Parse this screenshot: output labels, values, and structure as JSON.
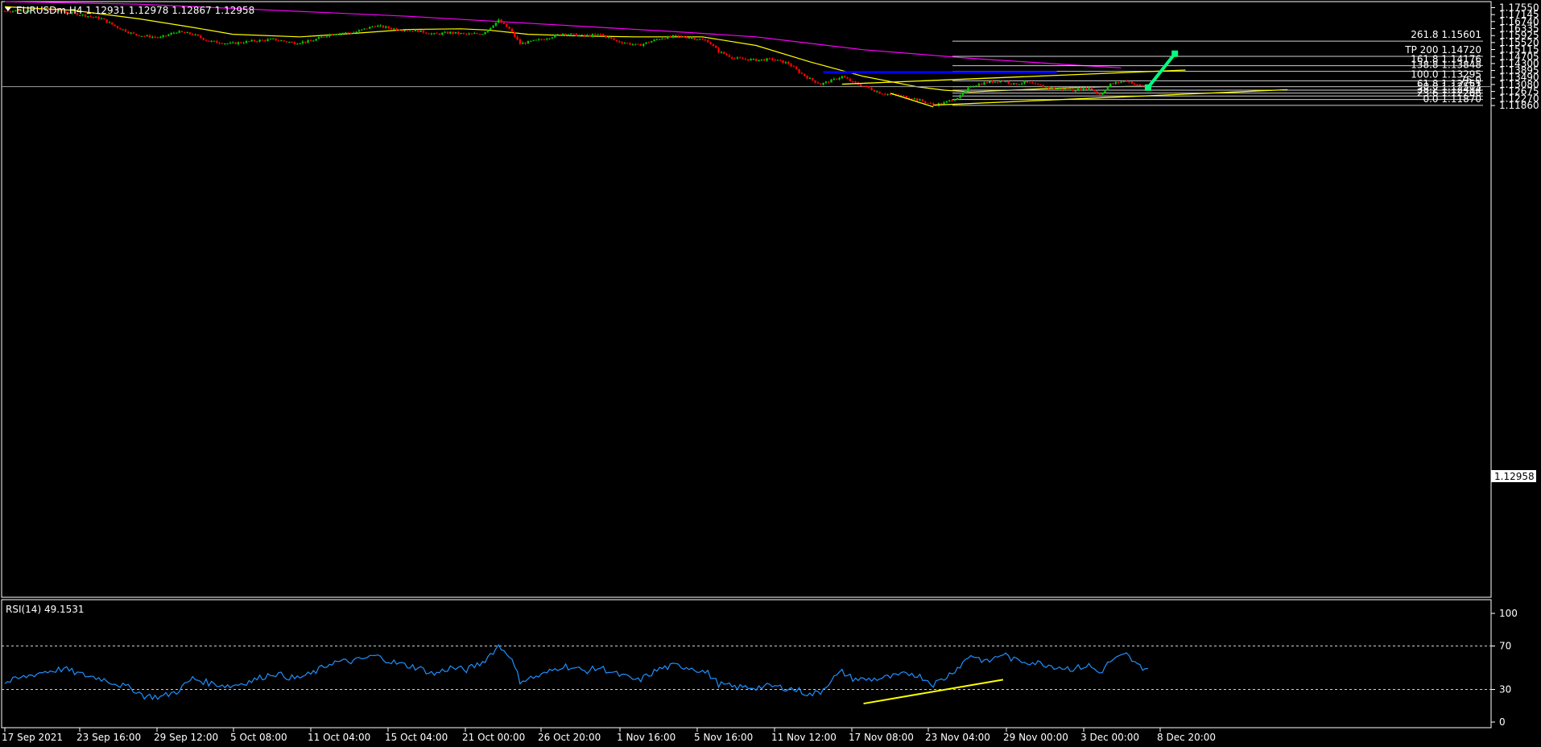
{
  "header": {
    "title": "EURUSDm,H4  1.12931 1.12978 1.12867 1.12958"
  },
  "price_tag": "1.12958",
  "rsi_header": "RSI(14) 49.1531",
  "colors": {
    "background": "#000000",
    "bull": "#00c800",
    "bear": "#ff0000",
    "ma_fast": "#ffff00",
    "ma_slow": "#ff00ff",
    "rsi": "#1e90ff",
    "zone": "#0000ff",
    "projection": "#00ff80",
    "grid": "#ffffff"
  },
  "chart_data": [
    {
      "type": "candlestick",
      "symbol": "EURUSDm",
      "timeframe": "H4",
      "ohlc_header": {
        "open": 1.12931,
        "high": 1.12978,
        "low": 1.12867,
        "close": 1.12958
      },
      "y_ticks": [
        "1.17550",
        "1.17145",
        "1.16740",
        "1.16335",
        "1.15925",
        "1.15520",
        "1.15115",
        "1.14705",
        "1.14300",
        "1.13895",
        "1.13490",
        "1.13080",
        "1.12675",
        "1.12270",
        "1.11860"
      ],
      "ylim": [
        1.116,
        1.179
      ],
      "x_ticks": [
        "17 Sep 2021",
        "23 Sep 16:00",
        "29 Sep 12:00",
        "5 Oct 08:00",
        "11 Oct 04:00",
        "15 Oct 04:00",
        "21 Oct 00:00",
        "26 Oct 20:00",
        "1 Nov 16:00",
        "5 Nov 16:00",
        "11 Nov 12:00",
        "17 Nov 08:00",
        "23 Nov 04:00",
        "29 Nov 00:00",
        "3 Dec 00:00",
        "8 Dec 20:00"
      ],
      "close_path": [
        [
          0,
          1.1735
        ],
        [
          8,
          1.174
        ],
        [
          14,
          1.1745
        ],
        [
          22,
          1.173
        ],
        [
          28,
          1.1715
        ],
        [
          36,
          1.169
        ],
        [
          42,
          1.164
        ],
        [
          48,
          1.16
        ],
        [
          52,
          1.159
        ],
        [
          58,
          1.158
        ],
        [
          64,
          1.1615
        ],
        [
          70,
          1.16
        ],
        [
          76,
          1.156
        ],
        [
          84,
          1.1545
        ],
        [
          92,
          1.156
        ],
        [
          100,
          1.157
        ],
        [
          108,
          1.155
        ],
        [
          114,
          1.156
        ],
        [
          122,
          1.1605
        ],
        [
          130,
          1.161
        ],
        [
          138,
          1.165
        ],
        [
          146,
          1.163
        ],
        [
          154,
          1.162
        ],
        [
          160,
          1.16
        ],
        [
          166,
          1.161
        ],
        [
          172,
          1.16
        ],
        [
          178,
          1.1605
        ],
        [
          184,
          1.168
        ],
        [
          188,
          1.163
        ],
        [
          192,
          1.1545
        ],
        [
          200,
          1.157
        ],
        [
          208,
          1.1605
        ],
        [
          216,
          1.159
        ],
        [
          222,
          1.16
        ],
        [
          228,
          1.156
        ],
        [
          236,
          1.1535
        ],
        [
          244,
          1.1575
        ],
        [
          250,
          1.159
        ],
        [
          256,
          1.158
        ],
        [
          262,
          1.156
        ],
        [
          266,
          1.15
        ],
        [
          272,
          1.146
        ],
        [
          280,
          1.145
        ],
        [
          286,
          1.1455
        ],
        [
          292,
          1.143
        ],
        [
          296,
          1.138
        ],
        [
          300,
          1.134
        ],
        [
          304,
          1.131
        ],
        [
          308,
          1.133
        ],
        [
          312,
          1.1355
        ],
        [
          316,
          1.132
        ],
        [
          320,
          1.13
        ],
        [
          326,
          1.126
        ],
        [
          332,
          1.1245
        ],
        [
          338,
          1.123
        ],
        [
          342,
          1.121
        ],
        [
          346,
          1.119
        ],
        [
          350,
          1.12
        ],
        [
          356,
          1.124
        ],
        [
          360,
          1.13
        ],
        [
          366,
          1.132
        ],
        [
          372,
          1.133
        ],
        [
          376,
          1.131
        ],
        [
          380,
          1.132
        ],
        [
          386,
          1.13
        ],
        [
          392,
          1.1285
        ],
        [
          398,
          1.1275
        ],
        [
          404,
          1.129
        ],
        [
          408,
          1.125
        ],
        [
          412,
          1.131
        ],
        [
          418,
          1.133
        ],
        [
          422,
          1.1305
        ],
        [
          426,
          1.1294
        ]
      ],
      "series": [
        {
          "name": "MA fast (yellow)",
          "points": [
            [
              0,
              1.176
            ],
            [
              25,
              1.174
            ],
            [
              50,
              1.169
            ],
            [
              70,
              1.164
            ],
            [
              85,
              1.16
            ],
            [
              110,
              1.1585
            ],
            [
              130,
              1.1605
            ],
            [
              150,
              1.1628
            ],
            [
              170,
              1.1632
            ],
            [
              180,
              1.1625
            ],
            [
              195,
              1.16
            ],
            [
              215,
              1.159
            ],
            [
              235,
              1.1585
            ],
            [
              260,
              1.1585
            ],
            [
              280,
              1.1535
            ],
            [
              300,
              1.144
            ],
            [
              320,
              1.1355
            ],
            [
              340,
              1.1295
            ],
            [
              350,
              1.1275
            ],
            [
              360,
              1.1265
            ],
            [
              375,
              1.1275
            ],
            [
              390,
              1.1285
            ],
            [
              410,
              1.1295
            ],
            [
              425,
              1.1298
            ]
          ]
        },
        {
          "name": "MA slow (magenta)",
          "points": [
            [
              0,
              1.179
            ],
            [
              50,
              1.1775
            ],
            [
              100,
              1.174
            ],
            [
              150,
              1.1705
            ],
            [
              200,
              1.166
            ],
            [
              250,
              1.1615
            ],
            [
              280,
              1.1585
            ],
            [
              320,
              1.151
            ],
            [
              360,
              1.146
            ],
            [
              400,
              1.142
            ],
            [
              416,
              1.1405
            ]
          ]
        }
      ],
      "fibonacci": [
        {
          "label": "261.8 1.15601",
          "price": 1.15601
        },
        {
          "label": "TP 200 1.14720",
          "price": 1.1472
        },
        {
          "label": "161.8 1.14176",
          "price": 1.14176
        },
        {
          "label": "138.8 1.13848",
          "price": 1.13848
        },
        {
          "label": "100.0 1.13295",
          "price": 1.13295
        },
        {
          "label": "75.0",
          "price": 1.12958
        },
        {
          "label": "61.8 1.12751",
          "price": 1.12751
        },
        {
          "label": "50.0 1.12583",
          "price": 1.12583
        },
        {
          "label": "38.2 1.12414",
          "price": 1.12414
        },
        {
          "label": "23.6 1.12206",
          "price": 1.12206
        },
        {
          "label": "0.0 1.11870",
          "price": 1.1187
        }
      ],
      "resistance_zone": {
        "from": [
          305,
          1.1386
        ],
        "to": [
          392,
          1.1372
        ]
      },
      "trendlines": [
        {
          "from": [
            312,
            1.131
          ],
          "to": [
            440,
            1.1392
          ]
        },
        {
          "from": [
            346,
            1.1188
          ],
          "to": [
            478,
            1.1278
          ]
        },
        {
          "from": [
            330,
            1.1257
          ],
          "to": [
            346,
            1.1178
          ]
        }
      ],
      "projection": {
        "from": [
          426,
          1.129
        ],
        "to": [
          436,
          1.1487
        ]
      },
      "current_price": 1.12958
    },
    {
      "type": "line",
      "title": "RSI(14) 49.1531",
      "ylim": [
        0,
        100
      ],
      "y_ticks": [
        "100",
        "70",
        "30",
        "0"
      ],
      "levels": [
        70,
        30
      ],
      "rsi_path": [
        [
          0,
          36
        ],
        [
          8,
          42
        ],
        [
          14,
          46
        ],
        [
          22,
          49
        ],
        [
          28,
          44
        ],
        [
          36,
          40
        ],
        [
          42,
          35
        ],
        [
          48,
          30
        ],
        [
          52,
          24
        ],
        [
          58,
          23
        ],
        [
          64,
          28
        ],
        [
          70,
          40
        ],
        [
          76,
          36
        ],
        [
          84,
          33
        ],
        [
          92,
          38
        ],
        [
          100,
          45
        ],
        [
          108,
          40
        ],
        [
          114,
          44
        ],
        [
          122,
          55
        ],
        [
          130,
          56
        ],
        [
          138,
          61
        ],
        [
          146,
          54
        ],
        [
          154,
          50
        ],
        [
          160,
          44
        ],
        [
          166,
          50
        ],
        [
          172,
          48
        ],
        [
          178,
          55
        ],
        [
          184,
          70
        ],
        [
          188,
          62
        ],
        [
          192,
          38
        ],
        [
          200,
          43
        ],
        [
          208,
          52
        ],
        [
          216,
          47
        ],
        [
          222,
          50
        ],
        [
          228,
          44
        ],
        [
          236,
          38
        ],
        [
          244,
          49
        ],
        [
          250,
          52
        ],
        [
          256,
          50
        ],
        [
          262,
          45
        ],
        [
          266,
          35
        ],
        [
          272,
          32
        ],
        [
          280,
          32
        ],
        [
          286,
          33
        ],
        [
          292,
          31
        ],
        [
          296,
          29
        ],
        [
          300,
          25
        ],
        [
          304,
          28
        ],
        [
          308,
          39
        ],
        [
          312,
          46
        ],
        [
          316,
          40
        ],
        [
          320,
          39
        ],
        [
          326,
          40
        ],
        [
          332,
          42
        ],
        [
          338,
          45
        ],
        [
          342,
          41
        ],
        [
          346,
          35
        ],
        [
          350,
          40
        ],
        [
          356,
          52
        ],
        [
          360,
          62
        ],
        [
          366,
          55
        ],
        [
          372,
          63
        ],
        [
          376,
          57
        ],
        [
          380,
          56
        ],
        [
          386,
          54
        ],
        [
          392,
          51
        ],
        [
          398,
          49
        ],
        [
          404,
          52
        ],
        [
          408,
          45
        ],
        [
          412,
          56
        ],
        [
          418,
          62
        ],
        [
          422,
          52
        ],
        [
          426,
          49
        ]
      ],
      "trendline": {
        "from": [
          320,
          17
        ],
        "to": [
          372,
          39
        ]
      }
    }
  ]
}
